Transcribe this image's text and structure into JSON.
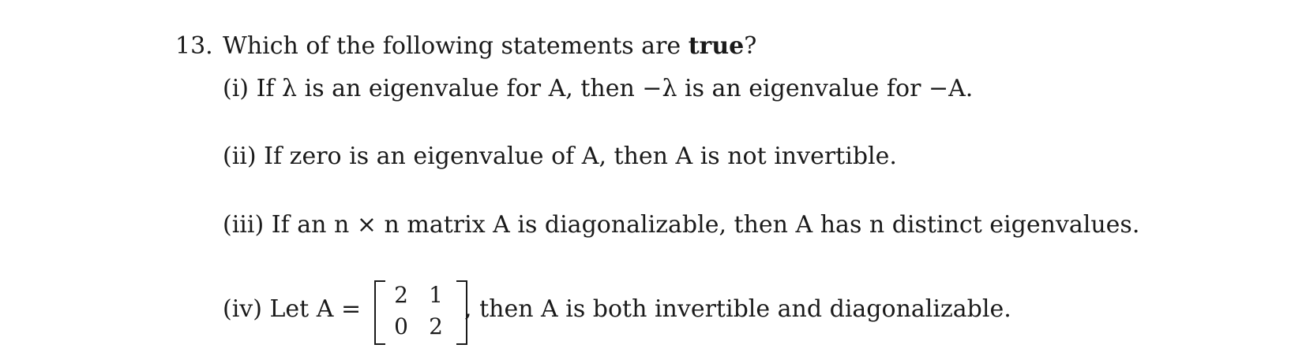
{
  "question": {
    "number": "13.",
    "stem_before": "Which of the following statements are ",
    "stem_bold": "true",
    "stem_after": "?"
  },
  "items": [
    {
      "label": "(i)",
      "text": "If λ is an eigenvalue for A, then −λ is an eigenvalue for −A."
    },
    {
      "label": "(ii)",
      "text": "If zero is an eigenvalue of A, then A is not invertible."
    },
    {
      "label": "(iii)",
      "text": "If an n × n matrix A is diagonalizable, then A has n distinct eigenvalues."
    },
    {
      "label": "(iv)",
      "prefix": "Let A =",
      "matrix": [
        "2",
        "1",
        "0",
        "2"
      ],
      "suffix": ", then A is both invertible and diagonalizable."
    }
  ]
}
